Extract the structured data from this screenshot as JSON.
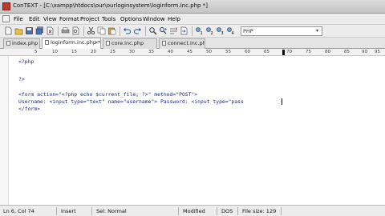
{
  "window": {
    "title": "ConTEXT - [C:\\xampp\\htdocs\\our\\ourloginsystem\\loginform.inc.php *]"
  },
  "menu": [
    "File",
    "Edit",
    "View",
    "Format",
    "Project",
    "Tools",
    "Options",
    "Window",
    "Help"
  ],
  "toolbar": {
    "highlighter_value": "PHP",
    "highlighter_arrow": "▾",
    "buttons": [
      "new-file-icon",
      "open-folder-icon",
      "save-icon",
      "save-all-icon",
      "close-file-icon",
      "print-icon",
      "print-preview-icon",
      "cut-icon",
      "copy-icon",
      "paste-icon",
      "undo-icon",
      "redo-icon",
      "find-icon",
      "find-next-icon",
      "replace-icon",
      "goto-line-icon",
      "user-exec-1-icon",
      "user-exec-2-icon",
      "user-exec-3-icon",
      "user-exec-4-icon"
    ]
  },
  "tabs": [
    {
      "label": "index.php",
      "close": ""
    },
    {
      "label": "loginform.inc.php *",
      "close": "×"
    },
    {
      "label": "core.inc.php",
      "close": ""
    },
    {
      "label": "connect.inc.php",
      "close": ""
    }
  ],
  "ruler": {
    "labels": [
      "5",
      "10",
      "15",
      "20",
      "25",
      "30",
      "35",
      "40",
      "45",
      "50",
      "55",
      "60",
      "65",
      "70",
      "75",
      "80",
      "85",
      "90",
      "95"
    ]
  },
  "code": [
    "<?php",
    "",
    "?>",
    "",
    "<form action=\"<?php echo $current_file; ?>\" method=\"POST\">",
    "Username: <input type=\"text\" name=\"username\"> Password: <input type=\"pass",
    "</form>"
  ],
  "status": {
    "position": "Ln 6, Col 74",
    "insert_mode": "Insert",
    "selection_mode": "Sel: Normal",
    "modified": "Modified",
    "file_format": "DOS",
    "file_size": "File size: 129"
  },
  "colors": {
    "code_text": "#1b2a8a",
    "chrome_bg": "#ececec"
  }
}
